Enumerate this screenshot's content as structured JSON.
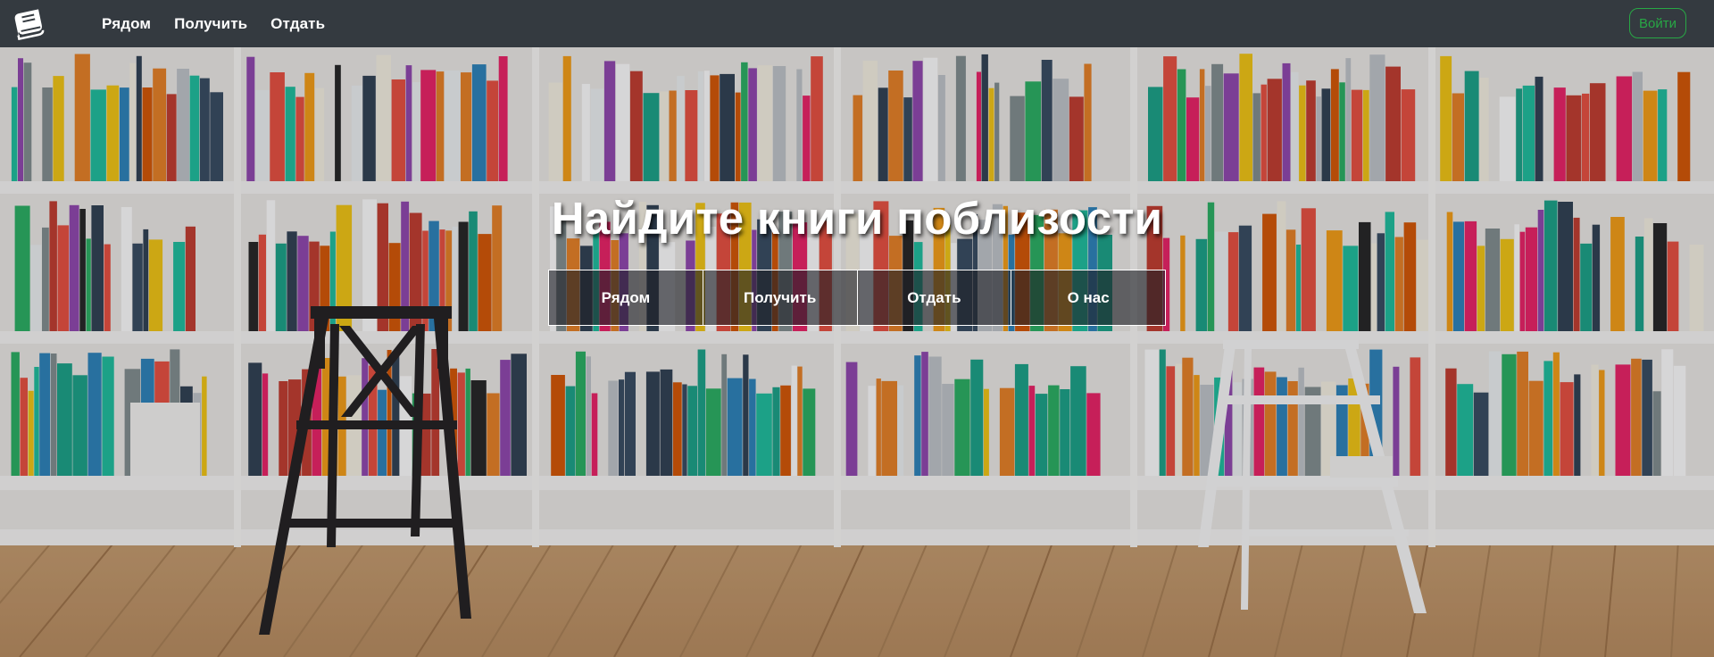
{
  "navbar": {
    "brand_icon": "book-icon",
    "links": [
      {
        "label": "Рядом"
      },
      {
        "label": "Получить"
      },
      {
        "label": "Отдать"
      }
    ],
    "login_label": "Войти"
  },
  "hero": {
    "title": "Найдите книги поблизости",
    "buttons": [
      {
        "label": "Рядом"
      },
      {
        "label": "Получить"
      },
      {
        "label": "Отдать"
      },
      {
        "label": "О нас"
      }
    ]
  },
  "colors": {
    "navbar_bg": "#343a40",
    "login_accent": "#28a745"
  }
}
